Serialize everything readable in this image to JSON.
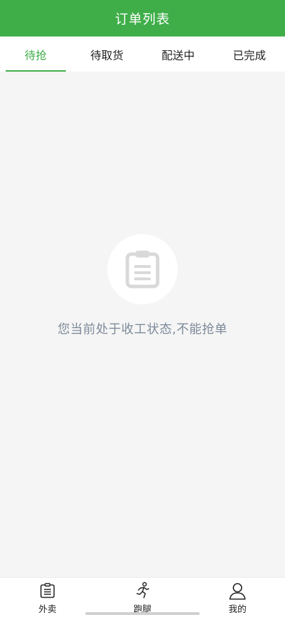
{
  "header": {
    "title": "订单列表"
  },
  "tabs": [
    {
      "label": "待抢",
      "active": true
    },
    {
      "label": "待取货",
      "active": false
    },
    {
      "label": "配送中",
      "active": false
    },
    {
      "label": "已完成",
      "active": false
    }
  ],
  "empty_state": {
    "icon": "clipboard-icon",
    "message": "您当前处于收工状态,不能抢单"
  },
  "bottom_nav": [
    {
      "label": "外卖",
      "icon": "list-icon"
    },
    {
      "label": "跑腿",
      "icon": "runner-icon"
    },
    {
      "label": "我的",
      "icon": "user-icon"
    }
  ],
  "colors": {
    "brand": "#3fae49",
    "empty_text": "#7d8a9a",
    "background": "#f5f5f5"
  }
}
